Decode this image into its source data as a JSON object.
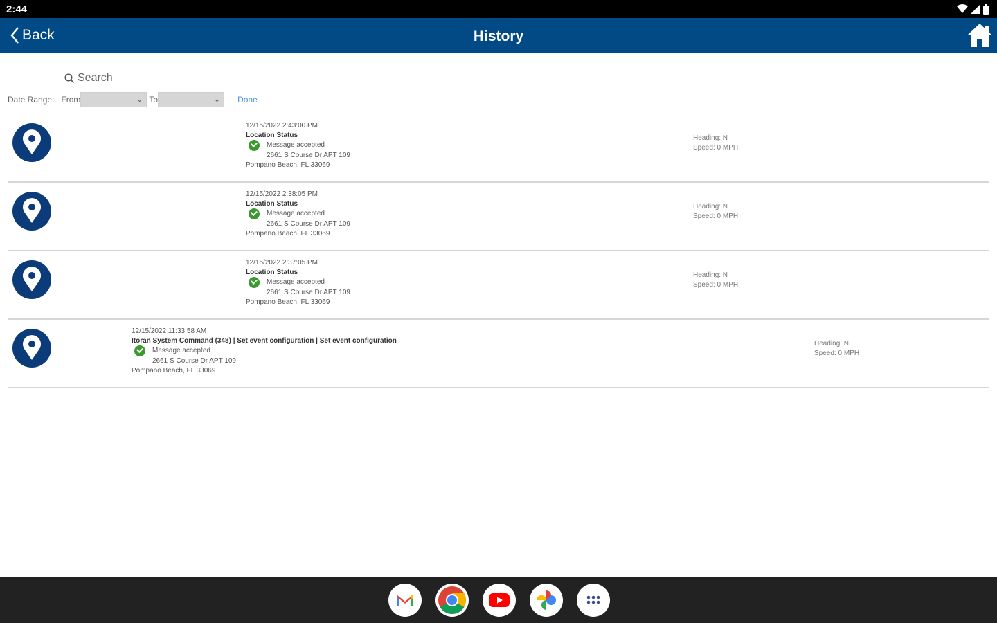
{
  "status_bar": {
    "time": "2:44"
  },
  "app_bar": {
    "back_label": "Back",
    "title": "History"
  },
  "search": {
    "label": "Search"
  },
  "filter": {
    "date_range_label": "Date Range:",
    "from_label": "From",
    "to_label": "To",
    "from_value": "",
    "to_value": "",
    "done_label": "Done"
  },
  "history": [
    {
      "datetime": "12/15/2022 2:43:00 PM",
      "type": "Location Status",
      "status": "Message accepted",
      "address": "2661 S Course Dr APT 109",
      "city": "Pompano Beach, FL 33069",
      "heading": "Heading: N",
      "speed": "Speed: 0 MPH"
    },
    {
      "datetime": "12/15/2022 2:38:05 PM",
      "type": "Location Status",
      "status": "Message accepted",
      "address": "2661 S Course Dr APT 109",
      "city": "Pompano Beach, FL 33069",
      "heading": "Heading: N",
      "speed": "Speed: 0 MPH"
    },
    {
      "datetime": "12/15/2022 2:37:05 PM",
      "type": "Location Status",
      "status": "Message accepted",
      "address": "2661 S Course Dr APT 109",
      "city": "Pompano Beach, FL 33069",
      "heading": "Heading: N",
      "speed": "Speed: 0 MPH"
    },
    {
      "datetime": "12/15/2022 11:33:58 AM",
      "type": "Itoran System Command (348) | Set event configuration | Set event configuration",
      "status": "Message accepted",
      "address": "2661 S Course Dr APT 109",
      "city": "Pompano Beach, FL 33069",
      "heading": "Heading: N",
      "speed": "Speed: 0 MPH"
    }
  ],
  "dock": {
    "apps": [
      "gmail-icon",
      "chrome-icon",
      "youtube-icon",
      "photos-icon",
      "app-drawer-icon"
    ]
  },
  "colors": {
    "app_bar": "#024a86",
    "pin": "#0c3b7a",
    "check": "#3a9a2e",
    "link": "#4a90e2"
  }
}
